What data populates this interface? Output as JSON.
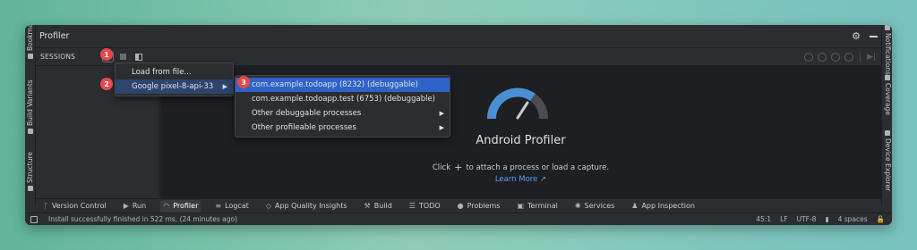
{
  "window": {
    "title": "Profiler",
    "sessions_label": "SESSIONS"
  },
  "side_tabs": {
    "left": [
      "Bookmarks",
      "Build Variants",
      "Structure"
    ],
    "right": [
      "Notifications",
      "Coverage",
      "Device Explorer"
    ]
  },
  "menu": {
    "items": [
      {
        "label": "Load from file..."
      },
      {
        "label": "Google pixel-8-api-33"
      }
    ]
  },
  "submenu": {
    "items": [
      {
        "label": "com.example.todoapp (8232) (debuggable)"
      },
      {
        "label": "com.example.todoapp.test (6753) (debuggable)"
      },
      {
        "label": "Other debuggable processes"
      },
      {
        "label": "Other profileable processes"
      }
    ]
  },
  "badges": [
    "1",
    "2",
    "3"
  ],
  "main": {
    "title": "Android Profiler",
    "hint_before": "Click",
    "hint_after": "to attach a process or load a capture.",
    "learn_more": "Learn More ↗"
  },
  "bottom_tabs": [
    {
      "label": "Version Control",
      "icon": "branch-icon"
    },
    {
      "label": "Run",
      "icon": "run-icon"
    },
    {
      "label": "Profiler",
      "icon": "profiler-icon"
    },
    {
      "label": "Logcat",
      "icon": "logcat-icon"
    },
    {
      "label": "App Quality Insights",
      "icon": "insights-icon"
    },
    {
      "label": "Build",
      "icon": "hammer-icon"
    },
    {
      "label": "TODO",
      "icon": "todo-icon"
    },
    {
      "label": "Problems",
      "icon": "problems-icon"
    },
    {
      "label": "Terminal",
      "icon": "terminal-icon"
    },
    {
      "label": "Services",
      "icon": "services-icon"
    },
    {
      "label": "App Inspection",
      "icon": "inspection-icon"
    }
  ],
  "status": {
    "message": "Install successfully finished in 522 ms. (24 minutes ago)",
    "position": "45:1",
    "line_ending": "LF",
    "encoding": "UTF-8",
    "indent": "4 spaces"
  },
  "colors": {
    "badge": "#e8474c",
    "selection": "#2e63c9",
    "gauge_blue": "#4a8fd4",
    "gauge_gray": "#4a4d52",
    "link": "#5c9eef"
  }
}
